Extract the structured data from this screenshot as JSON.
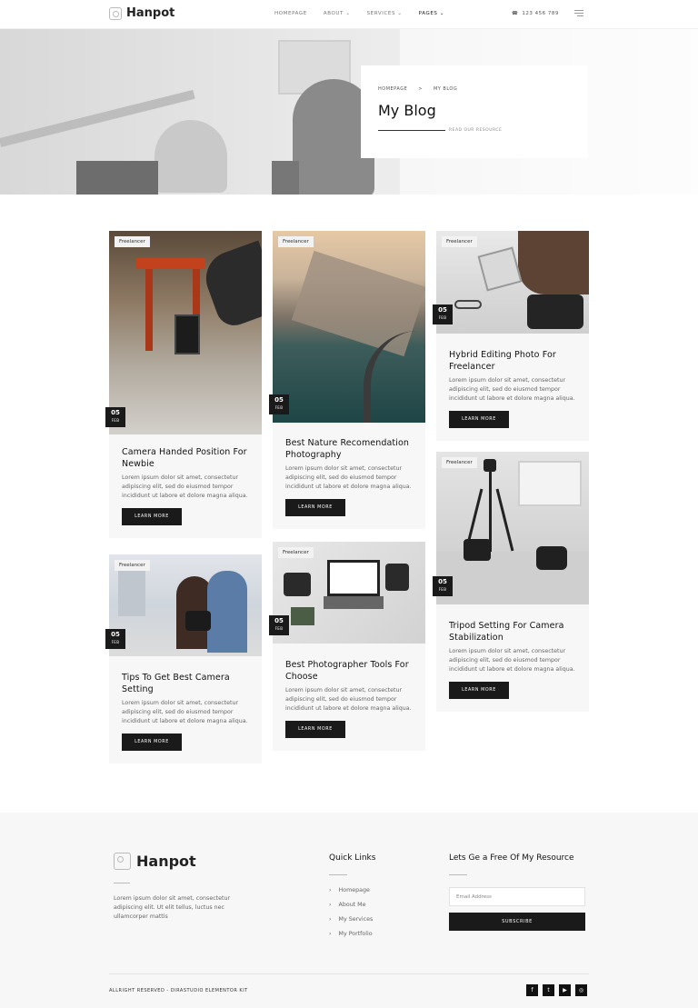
{
  "header": {
    "brand": "Hanpot",
    "nav": [
      "HOMEPAGE",
      "ABOUT ⌄",
      "SERVICES ⌄",
      "PAGES ⌄"
    ],
    "phone": "123 456 789"
  },
  "hero": {
    "breadcrumb_home": "HOMEPAGE",
    "breadcrumb_sep": ">",
    "breadcrumb_current": "MY BLOG",
    "title": "My Blog",
    "subtitle": "READ OUR RESOURCE"
  },
  "posts": [
    {
      "tag": "Freelancer",
      "day": "05",
      "month": "FEB",
      "title": "Camera Handed Position For Newbie",
      "excerpt": "Lorem ipsum dolor sit amet, consectetur adipiscing elit, sed do eiusmod tempor incididunt ut labore et dolore magna aliqua.",
      "button": "LEARN MORE"
    },
    {
      "tag": "Freelancer",
      "day": "05",
      "month": "FEB",
      "title": "Best Nature Recomendation Photography",
      "excerpt": "Lorem ipsum dolor sit amet, consectetur adipiscing elit, sed do eiusmod tempor incididunt ut labore et dolore magna aliqua.",
      "button": "LEARN MORE"
    },
    {
      "tag": "Freelancer",
      "day": "05",
      "month": "FEB",
      "title": "Hybrid Editing Photo For Freelancer",
      "excerpt": "Lorem ipsum dolor sit amet, consectetur adipiscing elit, sed do eiusmod tempor incididunt ut labore et dolore magna aliqua.",
      "button": "LEARN MORE"
    },
    {
      "tag": "Freelancer",
      "day": "05",
      "month": "FEB",
      "title": "Tips To Get Best Camera Setting",
      "excerpt": "Lorem ipsum dolor sit amet, consectetur adipiscing elit, sed do eiusmod tempor incididunt ut labore et dolore magna aliqua.",
      "button": "LEARN MORE"
    },
    {
      "tag": "Freelancer",
      "day": "05",
      "month": "FEB",
      "title": "Best Photographer Tools For Choose",
      "excerpt": "Lorem ipsum dolor sit amet, consectetur adipiscing elit, sed do eiusmod tempor incididunt ut labore et dolore magna aliqua.",
      "button": "LEARN MORE"
    },
    {
      "tag": "Freelancer",
      "day": "05",
      "month": "FEB",
      "title": "Tripod Setting For Camera Stabilization",
      "excerpt": "Lorem ipsum dolor sit amet, consectetur adipiscing elit, sed do eiusmod tempor incididunt ut labore et dolore magna aliqua.",
      "button": "LEARN MORE"
    }
  ],
  "footer": {
    "brand": "Hanpot",
    "description": "Lorem ipsum dolor sit amet, consectetur adipiscing elit. Ut elit tellus, luctus nec ullamcorper mattis",
    "quick_links_title": "Quick Links",
    "links": [
      "Homepage",
      "About Me",
      "My Services",
      "My Portfolio"
    ],
    "newsletter_title": "Lets Ge a Free Of My Resource",
    "email_placeholder": "Email Address",
    "subscribe": "SUBSCRIBE",
    "copyright": "ALLRIGHT RESERVED - DIRASTUDIO ELEMENTOR KIT"
  },
  "social_icons": [
    "facebook-icon",
    "twitter-icon",
    "youtube-icon",
    "instagram-icon"
  ]
}
